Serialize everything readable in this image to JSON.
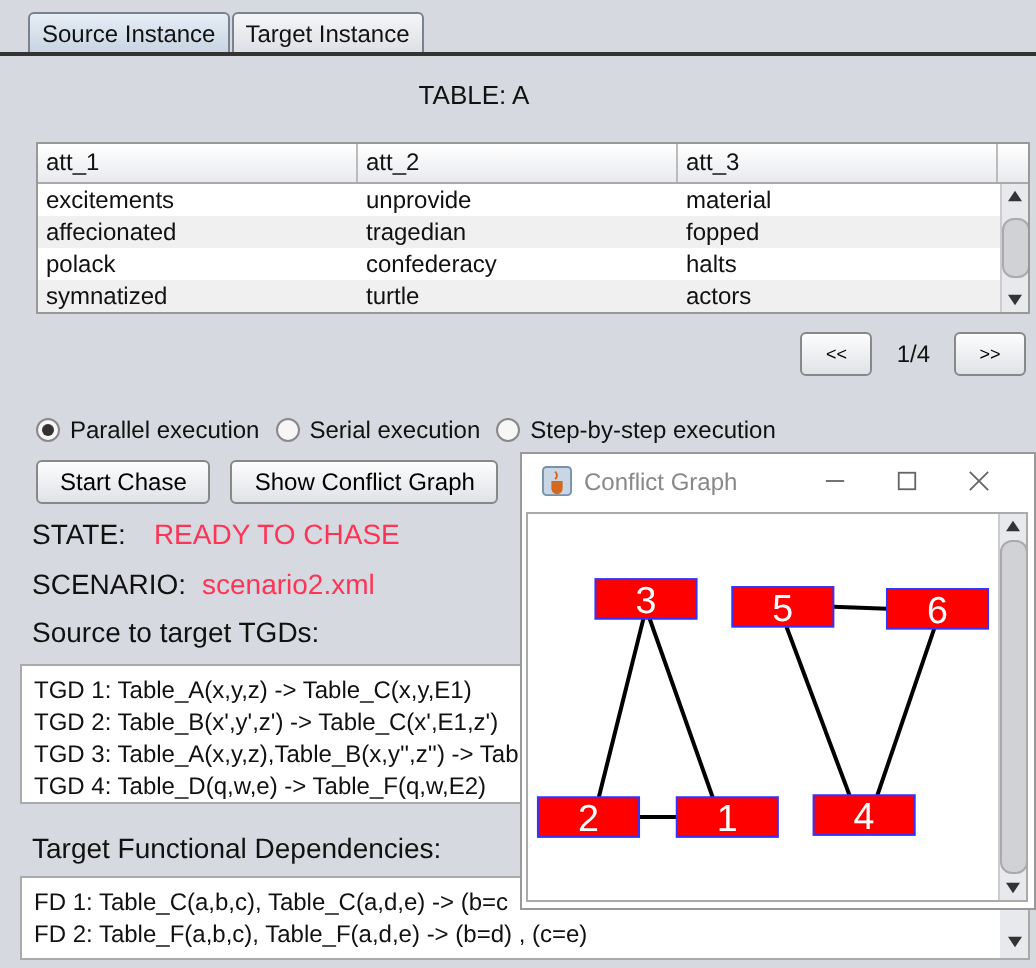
{
  "tabs": [
    {
      "label": "Source Instance",
      "selected": true
    },
    {
      "label": "Target Instance",
      "selected": false
    }
  ],
  "table_title": "TABLE: A",
  "table": {
    "columns": [
      "att_1",
      "att_2",
      "att_3"
    ],
    "rows": [
      [
        "excitements",
        "unprovide",
        "material"
      ],
      [
        "affecionated",
        "tragedian",
        "fopped"
      ],
      [
        "polack",
        "confederacy",
        "halts"
      ],
      [
        "symnatized",
        "turtle",
        "actors"
      ]
    ]
  },
  "pagination": {
    "prev": "<<",
    "page": "1/4",
    "next": ">>"
  },
  "execution_modes": [
    {
      "label": "Parallel execution",
      "selected": true
    },
    {
      "label": "Serial execution",
      "selected": false
    },
    {
      "label": "Step-by-step execution",
      "selected": false
    }
  ],
  "buttons": [
    "Start Chase",
    "Show Conflict Graph"
  ],
  "state": {
    "label": "STATE:",
    "value": "READY TO CHASE"
  },
  "scenario": {
    "label": "SCENARIO:",
    "value": "scenario2.xml"
  },
  "tgds": {
    "heading": "Source to target TGDs:",
    "lines": [
      "TGD 1: Table_A(x,y,z) -> Table_C(x,y,E1)",
      "TGD 2: Table_B(x',y',z') -> Table_C(x',E1,z')",
      "TGD 3: Table_A(x,y,z),Table_B(x,y'',z'') -> Tab",
      "TGD 4: Table_D(q,w,e) -> Table_F(q,w,E2)"
    ]
  },
  "fds": {
    "heading": "Target Functional Dependencies:",
    "lines": [
      "FD 1: Table_C(a,b,c), Table_C(a,d,e) -> (b=c",
      "FD 2: Table_F(a,b,c), Table_F(a,d,e) -> (b=d) , (c=e)"
    ]
  },
  "conflict_graph": {
    "title": "Conflict Graph",
    "nodes": [
      "3",
      "5",
      "6",
      "2",
      "1",
      "4"
    ]
  }
}
